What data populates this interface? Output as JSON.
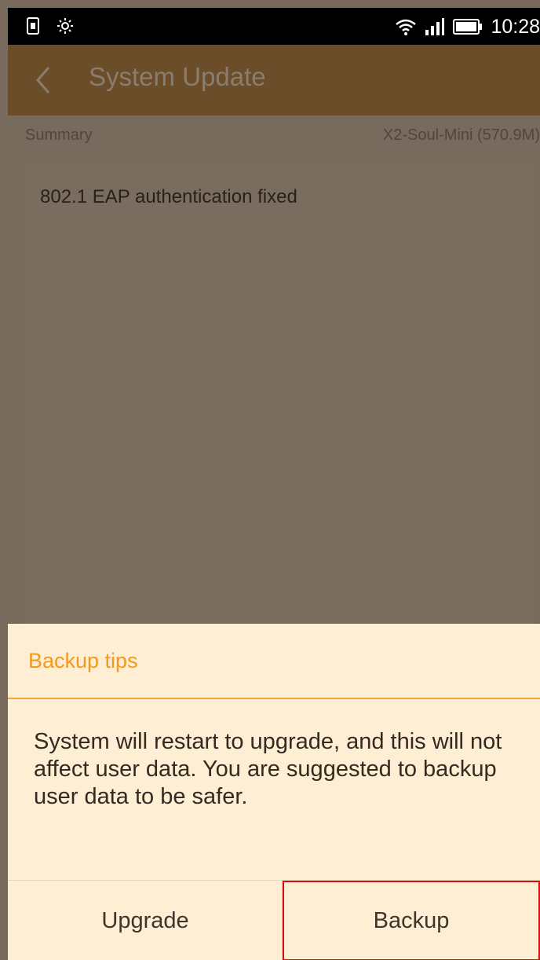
{
  "status_bar": {
    "time": "10:28",
    "icons": [
      "sim-card-icon",
      "brightness-icon",
      "wifi-icon",
      "signal-icon",
      "battery-icon"
    ]
  },
  "app_bar": {
    "title": "System Update",
    "back_icon": "back-chevron-icon"
  },
  "summary": {
    "label": "Summary",
    "package": "X2-Soul-Mini (570.9M)",
    "notes": "802.1 EAP authentication fixed"
  },
  "dialog": {
    "title": "Backup tips",
    "message": "System will restart to upgrade, and this will not affect user data. You are suggested to backup user data to be safer.",
    "buttons": {
      "upgrade": "Upgrade",
      "backup": "Backup"
    }
  },
  "colors": {
    "app_bar": "#6b4d2a",
    "accent": "#f39a1c",
    "dialog_bg": "#fdeed4",
    "highlight": "#d80f0f"
  }
}
